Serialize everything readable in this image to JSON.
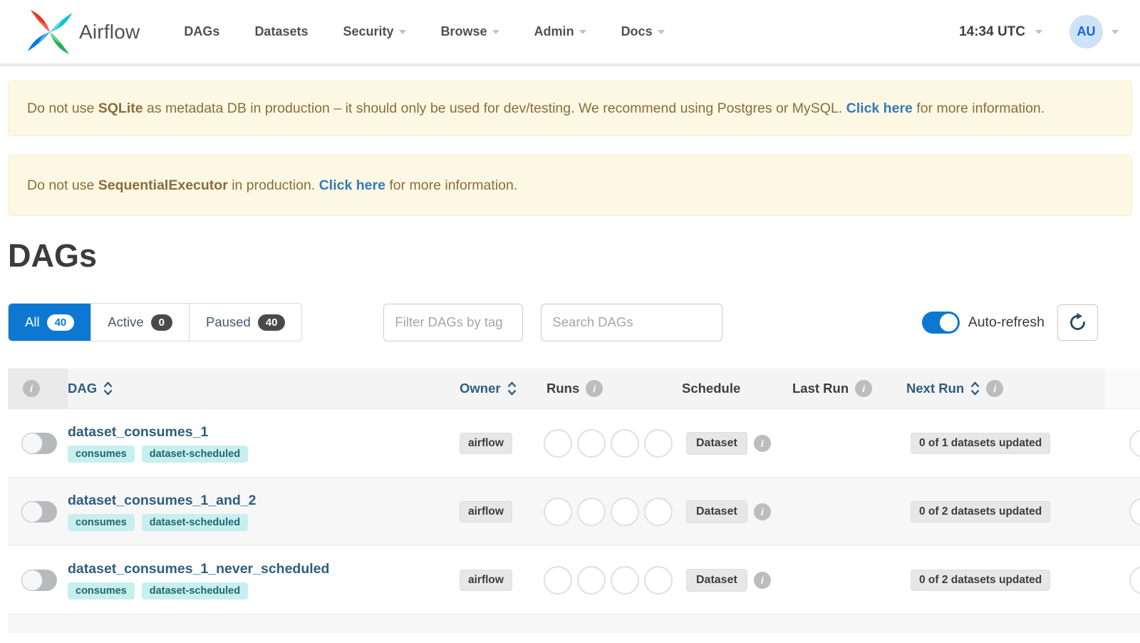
{
  "header": {
    "brand": "Airflow",
    "nav": [
      {
        "label": "DAGs",
        "caret": false
      },
      {
        "label": "Datasets",
        "caret": false
      },
      {
        "label": "Security",
        "caret": true
      },
      {
        "label": "Browse",
        "caret": true
      },
      {
        "label": "Admin",
        "caret": true
      },
      {
        "label": "Docs",
        "caret": true
      }
    ],
    "clock": "14:34 UTC",
    "avatar_initials": "AU"
  },
  "alerts": [
    {
      "prefix": "Do not use ",
      "strong": "SQLite",
      "middle": " as metadata DB in production – it should only be used for dev/testing. We recommend using Postgres or MySQL. ",
      "link": "Click here",
      "suffix": " for more information."
    },
    {
      "prefix": "Do not use ",
      "strong": "SequentialExecutor",
      "middle": " in production. ",
      "link": "Click here",
      "suffix": " for more information."
    }
  ],
  "page_title": "DAGs",
  "filters": {
    "tabs": [
      {
        "label": "All",
        "count": "40",
        "active": true
      },
      {
        "label": "Active",
        "count": "0",
        "active": false
      },
      {
        "label": "Paused",
        "count": "40",
        "active": false
      }
    ],
    "tag_filter_placeholder": "Filter DAGs by tag",
    "search_placeholder": "Search DAGs",
    "auto_refresh_label": "Auto-refresh",
    "auto_refresh_on": true
  },
  "table": {
    "columns": {
      "dag": "DAG",
      "owner": "Owner",
      "runs": "Runs",
      "schedule": "Schedule",
      "last_run": "Last Run",
      "next_run": "Next Run"
    },
    "rows": [
      {
        "name": "dataset_consumes_1",
        "tags": [
          "consumes",
          "dataset-scheduled"
        ],
        "owner": "airflow",
        "schedule": "Dataset",
        "next_run": "0 of 1 datasets updated"
      },
      {
        "name": "dataset_consumes_1_and_2",
        "tags": [
          "consumes",
          "dataset-scheduled"
        ],
        "owner": "airflow",
        "schedule": "Dataset",
        "next_run": "0 of 2 datasets updated"
      },
      {
        "name": "dataset_consumes_1_never_scheduled",
        "tags": [
          "consumes",
          "dataset-scheduled"
        ],
        "owner": "airflow",
        "schedule": "Dataset",
        "next_run": "0 of 2 datasets updated"
      }
    ]
  },
  "icons": {
    "info_glyph": "i"
  },
  "colors": {
    "accent_blue": "#0d78d2",
    "link_navy": "#2e5e7e",
    "alert_bg": "#fcf8e3",
    "alert_text": "#8a6d3b",
    "alert_link": "#337ab7",
    "tag_bg": "#c8efef",
    "tag_text": "#22676e",
    "badge_gray": "#e7e7e7",
    "logo_red": "#e43921",
    "logo_cyan": "#00c7d4",
    "logo_blue": "#017cee",
    "logo_green": "#21b356"
  }
}
